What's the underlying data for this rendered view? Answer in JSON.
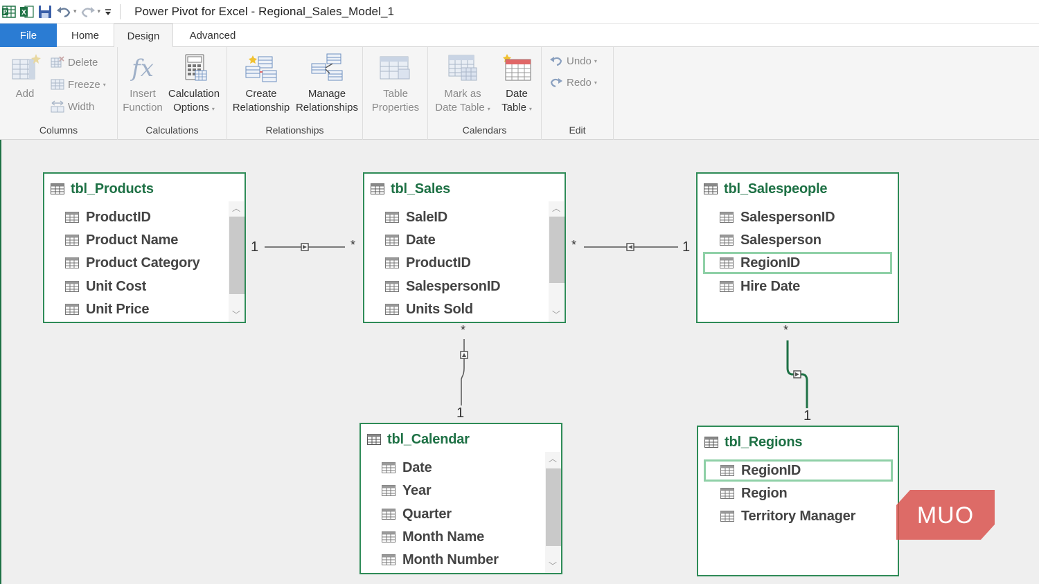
{
  "titlebar": {
    "title": "Power Pivot for Excel - Regional_Sales_Model_1",
    "qat_icons": [
      "power-pivot-icon",
      "excel-icon",
      "save-icon",
      "undo-icon",
      "redo-icon",
      "customize-qat-icon"
    ]
  },
  "tabs": [
    {
      "label": "File"
    },
    {
      "label": "Home"
    },
    {
      "label": "Design"
    },
    {
      "label": "Advanced"
    }
  ],
  "ribbon": {
    "columns": {
      "group_label": "Columns",
      "add": "Add",
      "delete": "Delete",
      "freeze": "Freeze",
      "width": "Width"
    },
    "calculations": {
      "group_label": "Calculations",
      "insert_function_1": "Insert",
      "insert_function_2": "Function",
      "calc_options_1": "Calculation",
      "calc_options_2": "Options"
    },
    "relationships": {
      "group_label": "Relationships",
      "create_1": "Create",
      "create_2": "Relationship",
      "manage_1": "Manage",
      "manage_2": "Relationships"
    },
    "table_props": {
      "line1": "Table",
      "line2": "Properties"
    },
    "calendars": {
      "group_label": "Calendars",
      "mark_1": "Mark as",
      "mark_2": "Date Table",
      "date_1": "Date",
      "date_2": "Table"
    },
    "edit": {
      "group_label": "Edit",
      "undo": "Undo",
      "redo": "Redo"
    }
  },
  "tables": {
    "products": {
      "title": "tbl_Products",
      "fields": [
        "ProductID",
        "Product Name",
        "Product Category",
        "Unit Cost",
        "Unit Price"
      ]
    },
    "sales": {
      "title": "tbl_Sales",
      "fields": [
        "SaleID",
        "Date",
        "ProductID",
        "SalespersonID",
        "Units Sold"
      ]
    },
    "salespeople": {
      "title": "tbl_Salespeople",
      "fields": [
        "SalespersonID",
        "Salesperson",
        "RegionID",
        "Hire Date"
      ]
    },
    "calendar": {
      "title": "tbl_Calendar",
      "fields": [
        "Date",
        "Year",
        "Quarter",
        "Month Name",
        "Month Number"
      ]
    },
    "regions": {
      "title": "tbl_Regions",
      "fields": [
        "RegionID",
        "Region",
        "Territory Manager"
      ]
    }
  },
  "relationships": {
    "products_sales": {
      "one": "1",
      "many": "*"
    },
    "sales_salespeople": {
      "many": "*",
      "one": "1"
    },
    "sales_calendar": {
      "many": "*",
      "one": "1"
    },
    "salespeople_regions": {
      "many": "*",
      "one": "1"
    }
  },
  "watermark": "MUO",
  "colors": {
    "accent_green": "#1e7145",
    "table_border": "#2e8b57",
    "highlight": "#8fd0a7",
    "file_tab": "#2b7cd3",
    "watermark": "#d9534f"
  }
}
